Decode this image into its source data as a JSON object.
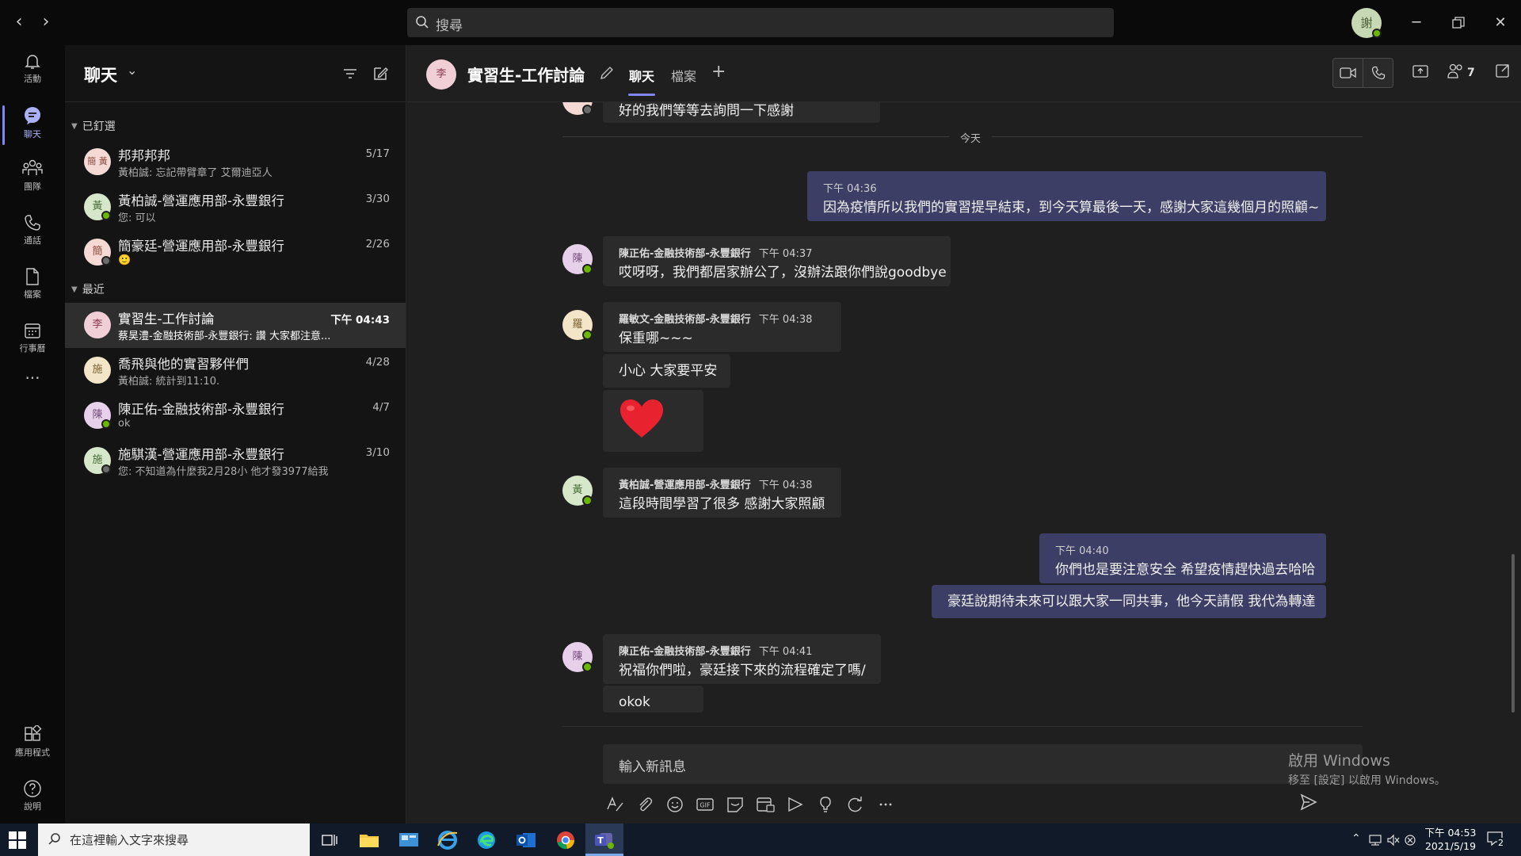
{
  "search": {
    "placeholder": "搜尋"
  },
  "user_avatar": {
    "initials": "謝"
  },
  "rail": [
    {
      "label": "活動",
      "icon": "bell-icon"
    },
    {
      "label": "聊天",
      "icon": "chat-icon"
    },
    {
      "label": "團隊",
      "icon": "teams-icon"
    },
    {
      "label": "通話",
      "icon": "phone-icon"
    },
    {
      "label": "檔案",
      "icon": "file-icon"
    },
    {
      "label": "行事曆",
      "icon": "calendar-icon"
    },
    {
      "label": "應用程式",
      "icon": "apps-icon"
    },
    {
      "label": "說明",
      "icon": "help-icon"
    }
  ],
  "chatlist": {
    "title": "聊天",
    "pinned_label": "已釘選",
    "recent_label": "最近",
    "pinned": [
      {
        "name": "邦邦邦邦",
        "preview": "黃柏誠: 忘記帶臂章了 艾爾迪亞人",
        "date": "5/17",
        "initials": "簡 黃"
      },
      {
        "name": "黃柏誠-營運應用部-永豐銀行",
        "preview": "您: 可以",
        "date": "3/30",
        "initials": "黃"
      },
      {
        "name": "簡豪廷-營運應用部-永豐銀行",
        "preview": "🙂",
        "date": "2/26",
        "initials": "簡"
      }
    ],
    "recent": [
      {
        "name": "實習生-工作討論",
        "preview": "蔡昊澧-金融技術部-永豐銀行: 讚 大家都注意...",
        "date": "下午 04:43",
        "initials": "李"
      },
      {
        "name": "喬飛與他的實習夥伴們",
        "preview": "黃柏誠: 統計到11:10.",
        "date": "4/28",
        "initials": "施"
      },
      {
        "name": "陳正佑-金融技術部-永豐銀行",
        "preview": "ok",
        "date": "4/7",
        "initials": "陳"
      },
      {
        "name": "施騏漢-營運應用部-永豐銀行",
        "preview": "您: 不知道為什麼我2月28小 他才發3977給我",
        "date": "3/10",
        "initials": "施"
      }
    ]
  },
  "conversation": {
    "title": "實習生-工作討論",
    "avatar_initials": "李",
    "tabs": [
      "聊天",
      "檔案"
    ],
    "participants": "7",
    "day_label": "今天",
    "top_cut_message": "好的我們等等去詢問一下感謝",
    "messages": [
      {
        "time": "下午 04:36",
        "text": "因為疫情所以我們的實習提早結束，到今天算最後一天，感謝大家這幾個月的照顧~"
      },
      {
        "sender": "陳正佑-金融技術部-永豐銀行",
        "time": "下午 04:37",
        "text": "哎呀呀，我們都居家辦公了，沒辦法跟你們說goodbye",
        "initials": "陳"
      },
      {
        "sender": "羅敏文-金融技術部-永豐銀行",
        "time": "下午 04:38",
        "text": "保重哪~~~",
        "initials": "羅",
        "followup": "小心 大家要平安"
      },
      {
        "sender": "黃柏誠-營運應用部-永豐銀行",
        "time": "下午 04:38",
        "text": "這段時間學習了很多 感謝大家照顧",
        "initials": "黃"
      },
      {
        "time": "下午 04:40",
        "text": "你們也是要注意安全 希望疫情趕快過去哈哈",
        "followup": "豪廷說期待未來可以跟大家一同共事，他今天請假 我代為轉達"
      },
      {
        "sender": "陳正佑-金融技術部-永豐銀行",
        "time": "下午 04:41",
        "text": "祝福你們啦，豪廷接下來的流程確定了嗎/",
        "initials": "陳",
        "followup": "okok"
      }
    ],
    "compose_placeholder": "輸入新訊息"
  },
  "watermark": {
    "line1": "啟用 Windows",
    "line2": "移至 [設定] 以啟用 Windows。"
  },
  "taskbar": {
    "search_placeholder": "在這裡輸入文字來搜尋",
    "time": "下午 04:53",
    "date": "2021/5/19",
    "notifications": "2"
  }
}
